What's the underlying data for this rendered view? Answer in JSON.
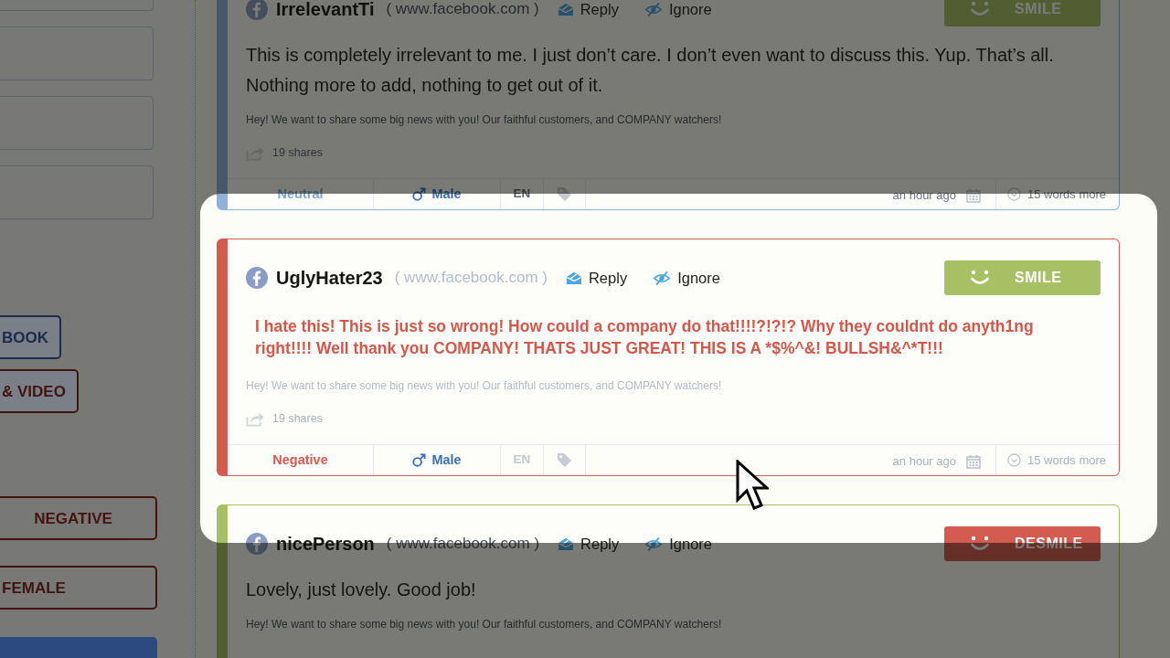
{
  "sidebar": {
    "filters": [
      {
        "kind": "source",
        "label": "BOOK",
        "color": "#1b2b4a"
      },
      {
        "kind": "source",
        "label": "& VIDEO",
        "color": "#3f1512"
      },
      {
        "kind": "sentiment",
        "label": "NEGATIVE",
        "color": "#45140f"
      },
      {
        "kind": "gender",
        "label": "FEMALE",
        "color": "#3f1512"
      },
      {
        "kind": "type",
        "color": "#2c4a80"
      }
    ]
  },
  "posts": [
    {
      "kind": "neutral",
      "focused": false,
      "alert": false,
      "author": "IrrelevantTi",
      "source": "( www.facebook.com )",
      "actions": [
        {
          "kind": "reply",
          "label": "Reply"
        },
        {
          "kind": "ignore",
          "label": "Ignore"
        }
      ],
      "reaction_button": {
        "kind": "smile",
        "label": "SMILE"
      },
      "body": "This is completely irrelevant to me. I just don’t care. I don’t even want to discuss this. Yup. That’s all. Nothing more to add, nothing to get out of it.",
      "share_text": "Hey! We want to share some big news with you! Our faithful customers, and COMPANY watchers!",
      "shares": "19 shares",
      "footer": {
        "sentiment": "Neutral",
        "gender": "Male",
        "language": "EN",
        "time": "an hour ago",
        "more": "15 words more"
      }
    },
    {
      "kind": "negative",
      "focused": true,
      "alert": true,
      "author": "UglyHater23",
      "source": "( www.facebook.com )",
      "actions": [
        {
          "kind": "reply",
          "label": "Reply"
        },
        {
          "kind": "ignore",
          "label": "Ignore"
        }
      ],
      "reaction_button": {
        "kind": "smile",
        "label": "SMILE"
      },
      "body": "I hate this! This is just so wrong! How could a company do that!!!!?!?!? Why they couldnt do anyth1ng right!!!! Well thank you COMPANY! THATS JUST GREAT! THIS IS A *$%^&! BULLSH&^*T!!!",
      "share_text": "Hey! We want to share some big news with you! Our faithful customers, and COMPANY watchers!",
      "shares": "19 shares",
      "footer": {
        "sentiment": "Negative",
        "gender": "Male",
        "language": "EN",
        "time": "an hour ago",
        "more": "15 words more"
      }
    },
    {
      "kind": "positive",
      "focused": false,
      "alert": false,
      "author": "nicePerson",
      "source": "( www.facebook.com )",
      "actions": [
        {
          "kind": "reply",
          "label": "Reply"
        },
        {
          "kind": "ignore",
          "label": "Ignore"
        }
      ],
      "reaction_button": {
        "kind": "desmile",
        "label": "DESMILE"
      },
      "body": "Lovely, just lovely. Good job!",
      "share_text": "Hey! We want to share some big news with you! Our faithful customers, and COMPANY watchers!"
    }
  ]
}
